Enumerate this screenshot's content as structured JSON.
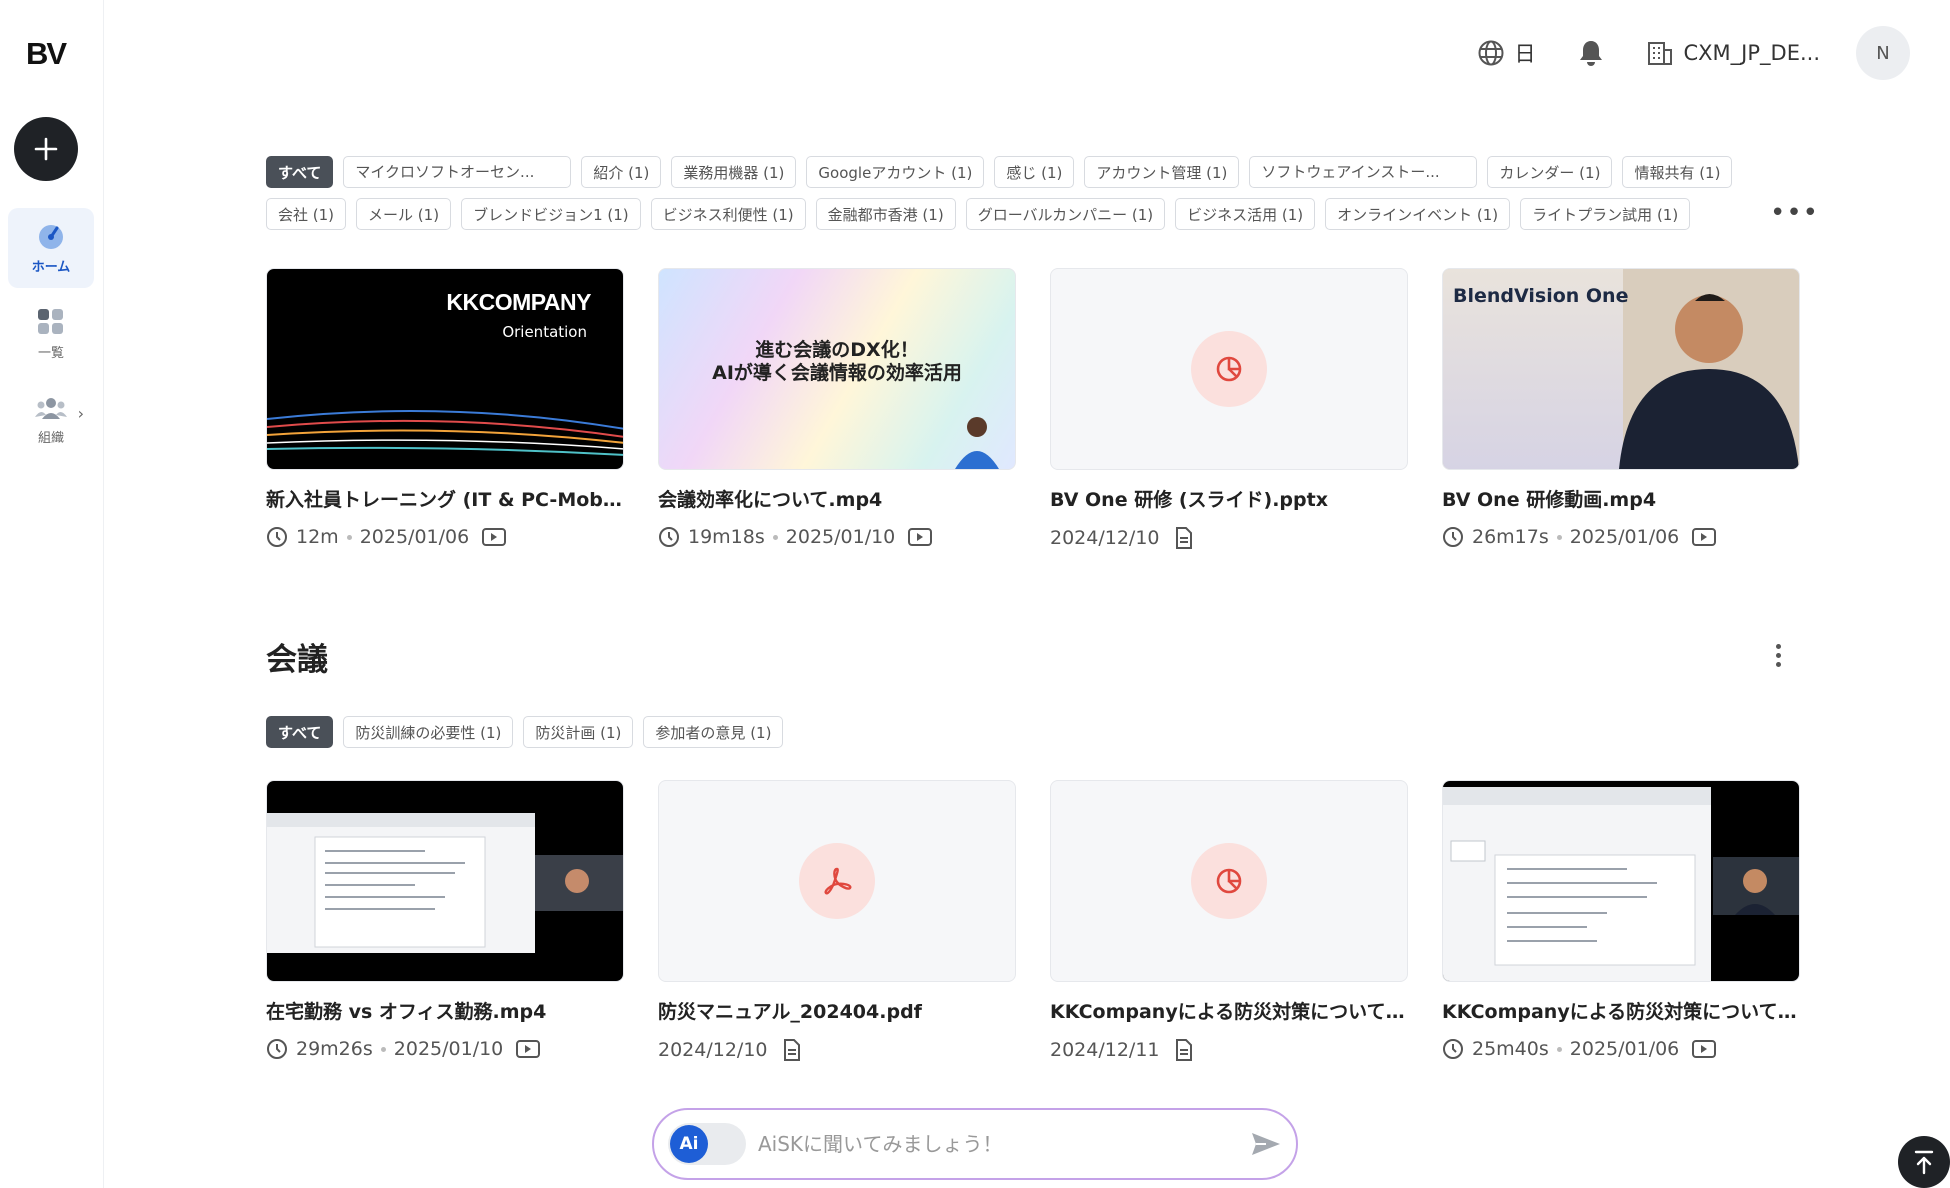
{
  "app": {
    "logo": "BV"
  },
  "header": {
    "language": "日",
    "org": "CXM_JP_DE...",
    "avatar": "N"
  },
  "sidebar": {
    "items": [
      {
        "label": "ホーム"
      },
      {
        "label": "一覧"
      },
      {
        "label": "組織"
      }
    ]
  },
  "section1": {
    "title": "",
    "tags_row1": [
      "すべて",
      "マイクロソフトオーセン...",
      "紹介 (1)",
      "業務用機器 (1)",
      "Googleアカウント (1)",
      "感じ (1)",
      "アカウント管理 (1)",
      "ソフトウェアインストー...",
      "カレンダー (1)",
      "情報共有 (1)"
    ],
    "tags_row2": [
      "会社 (1)",
      "メール (1)",
      "ブレンドビジョン1 (1)",
      "ビジネス利便性 (1)",
      "金融都市香港 (1)",
      "グローバルカンパニー (1)",
      "ビジネス活用 (1)",
      "オンラインイベント (1)",
      "ライトプラン試用 (1)"
    ],
    "more": "•••",
    "cards": [
      {
        "title": "新入社員トレーニング (IT & PC-Mobile ...",
        "duration": "12m",
        "date": "2025/01/06",
        "thumb_text1": "KKCOMPANY",
        "thumb_text2": "Orientation"
      },
      {
        "title": "会議効率化について.mp4",
        "duration": "19m18s",
        "date": "2025/01/10",
        "thumb_text1": "進む会議のDX化！",
        "thumb_text2": "AIが導く会議情報の効率活用"
      },
      {
        "title": "BV One 研修 (スライド).pptx",
        "date": "2024/12/10"
      },
      {
        "title": "BV One 研修動画.mp4",
        "duration": "26m17s",
        "date": "2025/01/06",
        "thumb_text1": "BlendVision One"
      }
    ]
  },
  "section2": {
    "title": "会議",
    "tags": [
      "すべて",
      "防災訓練の必要性 (1)",
      "防災計画 (1)",
      "参加者の意見 (1)"
    ],
    "cards": [
      {
        "title": "在宅勤務 vs オフィス勤務.mp4",
        "duration": "29m26s",
        "date": "2025/01/10"
      },
      {
        "title": "防災マニュアル_202404.pdf",
        "date": "2024/12/10"
      },
      {
        "title": "KKCompanyによる防災対策について(ス...",
        "date": "2024/12/11"
      },
      {
        "title": "KKCompanyによる防災対策について.m...",
        "duration": "25m40s",
        "date": "2025/01/06"
      }
    ]
  },
  "ai": {
    "placeholder": "AiSKに聞いてみましょう！",
    "toggle_label": "Ai"
  },
  "colors": {
    "accent": "#1e5ed6",
    "selected_tag": "#4a5058",
    "file_icon": "#e0483e"
  }
}
